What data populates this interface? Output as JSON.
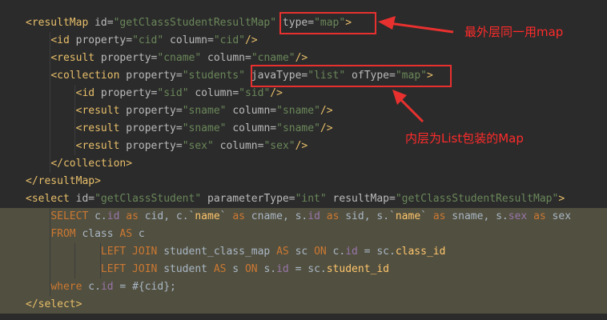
{
  "colors": {
    "background": "#2b2b2b",
    "tag": "#e8bf6a",
    "attribute": "#bababa",
    "value": "#6a8759",
    "sql_keyword": "#cc7832",
    "sql_identifier": "#a9b7c6",
    "highlight": "#514f3f",
    "annotation": "#ff2b2b"
  },
  "lines": [
    {
      "indent": "",
      "segments": [
        {
          "t": "<resultMap",
          "c": "tag"
        },
        {
          "t": " id=",
          "c": "attr"
        },
        {
          "t": "\"getClassStudentResultMap\"",
          "c": "val"
        },
        {
          "t": " type=",
          "c": "attr"
        },
        {
          "t": "\"map\"",
          "c": "val"
        },
        {
          "t": ">",
          "c": "tag"
        }
      ]
    },
    {
      "indent": "    ",
      "segments": [
        {
          "t": "<id",
          "c": "tag"
        },
        {
          "t": " property=",
          "c": "attr"
        },
        {
          "t": "\"cid\"",
          "c": "val"
        },
        {
          "t": " column=",
          "c": "attr"
        },
        {
          "t": "\"cid\"",
          "c": "val"
        },
        {
          "t": "/>",
          "c": "tag"
        }
      ]
    },
    {
      "indent": "    ",
      "segments": [
        {
          "t": "<result",
          "c": "tag"
        },
        {
          "t": " property=",
          "c": "attr"
        },
        {
          "t": "\"cname\"",
          "c": "val"
        },
        {
          "t": " column=",
          "c": "attr"
        },
        {
          "t": "\"cname\"",
          "c": "val"
        },
        {
          "t": "/>",
          "c": "tag"
        }
      ]
    },
    {
      "indent": "    ",
      "segments": [
        {
          "t": "<collection",
          "c": "tag"
        },
        {
          "t": " property=",
          "c": "attr"
        },
        {
          "t": "\"students\"",
          "c": "val"
        },
        {
          "t": " javaType=",
          "c": "attr"
        },
        {
          "t": "\"list\"",
          "c": "val"
        },
        {
          "t": " ofType=",
          "c": "attr"
        },
        {
          "t": "\"map\"",
          "c": "val"
        },
        {
          "t": ">",
          "c": "tag"
        }
      ]
    },
    {
      "indent": "        ",
      "segments": [
        {
          "t": "<id",
          "c": "tag"
        },
        {
          "t": " property=",
          "c": "attr"
        },
        {
          "t": "\"sid\"",
          "c": "val"
        },
        {
          "t": " column=",
          "c": "attr"
        },
        {
          "t": "\"sid\"",
          "c": "val"
        },
        {
          "t": "/>",
          "c": "tag"
        }
      ]
    },
    {
      "indent": "        ",
      "segments": [
        {
          "t": "<result",
          "c": "tag"
        },
        {
          "t": " property=",
          "c": "attr"
        },
        {
          "t": "\"sname\"",
          "c": "val"
        },
        {
          "t": " column=",
          "c": "attr"
        },
        {
          "t": "\"sname\"",
          "c": "val"
        },
        {
          "t": "/>",
          "c": "tag"
        }
      ]
    },
    {
      "indent": "        ",
      "segments": [
        {
          "t": "<result",
          "c": "tag"
        },
        {
          "t": " property=",
          "c": "attr"
        },
        {
          "t": "\"sname\"",
          "c": "val"
        },
        {
          "t": " column=",
          "c": "attr"
        },
        {
          "t": "\"sname\"",
          "c": "val"
        },
        {
          "t": "/>",
          "c": "tag"
        }
      ]
    },
    {
      "indent": "        ",
      "segments": [
        {
          "t": "<result",
          "c": "tag"
        },
        {
          "t": " property=",
          "c": "attr"
        },
        {
          "t": "\"sex\"",
          "c": "val"
        },
        {
          "t": " column=",
          "c": "attr"
        },
        {
          "t": "\"sex\"",
          "c": "val"
        },
        {
          "t": "/>",
          "c": "tag"
        }
      ]
    },
    {
      "indent": "    ",
      "segments": [
        {
          "t": "</collection>",
          "c": "tag"
        }
      ]
    },
    {
      "indent": "",
      "segments": [
        {
          "t": "</resultMap>",
          "c": "tag"
        }
      ]
    },
    {
      "indent": "",
      "highlight": "partial",
      "segments": [
        {
          "t": "<select",
          "c": "tag"
        },
        {
          "t": " id=",
          "c": "attr"
        },
        {
          "t": "\"getClassStudent\"",
          "c": "val"
        },
        {
          "t": " parameterType=",
          "c": "attr"
        },
        {
          "t": "\"int\"",
          "c": "val"
        },
        {
          "t": " resultMap=",
          "c": "attr"
        },
        {
          "t": "\"getClassStudentResultMap\"",
          "c": "val"
        },
        {
          "t": ">",
          "c": "tag"
        }
      ]
    },
    {
      "indent": "    ",
      "highlight": "full",
      "segments": [
        {
          "t": "SELECT",
          "c": "sqlkw"
        },
        {
          "t": " c.",
          "c": "sqlid"
        },
        {
          "t": "id",
          "c": "sqlfn"
        },
        {
          "t": " as",
          "c": "sqlkw"
        },
        {
          "t": " cid, c.`",
          "c": "sqlid"
        },
        {
          "t": "name",
          "c": "sqlcol"
        },
        {
          "t": "`",
          "c": "sqlid"
        },
        {
          "t": " as",
          "c": "sqlkw"
        },
        {
          "t": " cname, s.",
          "c": "sqlid"
        },
        {
          "t": "id",
          "c": "sqlfn"
        },
        {
          "t": " as",
          "c": "sqlkw"
        },
        {
          "t": " sid, s.`",
          "c": "sqlid"
        },
        {
          "t": "name",
          "c": "sqlcol"
        },
        {
          "t": "`",
          "c": "sqlid"
        },
        {
          "t": " as",
          "c": "sqlkw"
        },
        {
          "t": " sname, s.",
          "c": "sqlid"
        },
        {
          "t": "sex",
          "c": "sqlfn"
        },
        {
          "t": " as",
          "c": "sqlkw"
        },
        {
          "t": " sex",
          "c": "sqlid"
        }
      ]
    },
    {
      "indent": "    ",
      "highlight": "full",
      "segments": [
        {
          "t": "FROM",
          "c": "sqlkw"
        },
        {
          "t": " class ",
          "c": "sqlid"
        },
        {
          "t": "AS",
          "c": "sqlkw"
        },
        {
          "t": " c",
          "c": "sqlid"
        }
      ]
    },
    {
      "indent": "            ",
      "highlight": "full",
      "segments": [
        {
          "t": "LEFT JOIN",
          "c": "sqlkw"
        },
        {
          "t": " student_class_map ",
          "c": "sqlid"
        },
        {
          "t": "AS",
          "c": "sqlkw"
        },
        {
          "t": " sc ",
          "c": "sqlid"
        },
        {
          "t": "ON",
          "c": "sqlkw"
        },
        {
          "t": " c.",
          "c": "sqlid"
        },
        {
          "t": "id",
          "c": "sqlfn"
        },
        {
          "t": " = sc.",
          "c": "sqlid"
        },
        {
          "t": "class_id",
          "c": "sqlcol"
        }
      ]
    },
    {
      "indent": "            ",
      "highlight": "full",
      "segments": [
        {
          "t": "LEFT JOIN",
          "c": "sqlkw"
        },
        {
          "t": " student ",
          "c": "sqlid"
        },
        {
          "t": "AS",
          "c": "sqlkw"
        },
        {
          "t": " s ",
          "c": "sqlid"
        },
        {
          "t": "ON",
          "c": "sqlkw"
        },
        {
          "t": " s.",
          "c": "sqlid"
        },
        {
          "t": "id",
          "c": "sqlfn"
        },
        {
          "t": " = sc.",
          "c": "sqlid"
        },
        {
          "t": "student_id",
          "c": "sqlcol"
        }
      ]
    },
    {
      "indent": "    ",
      "highlight": "full",
      "segments": [
        {
          "t": "where",
          "c": "sqlkw"
        },
        {
          "t": " c.",
          "c": "sqlid"
        },
        {
          "t": "id",
          "c": "sqlfn"
        },
        {
          "t": " = #{cid};",
          "c": "sqlid"
        }
      ]
    },
    {
      "indent": "",
      "highlight": "full",
      "segments": [
        {
          "t": "</select>",
          "c": "tag"
        }
      ]
    }
  ],
  "annotations": {
    "outer": "最外层同一用map",
    "inner": "内层为List包装的Map"
  }
}
